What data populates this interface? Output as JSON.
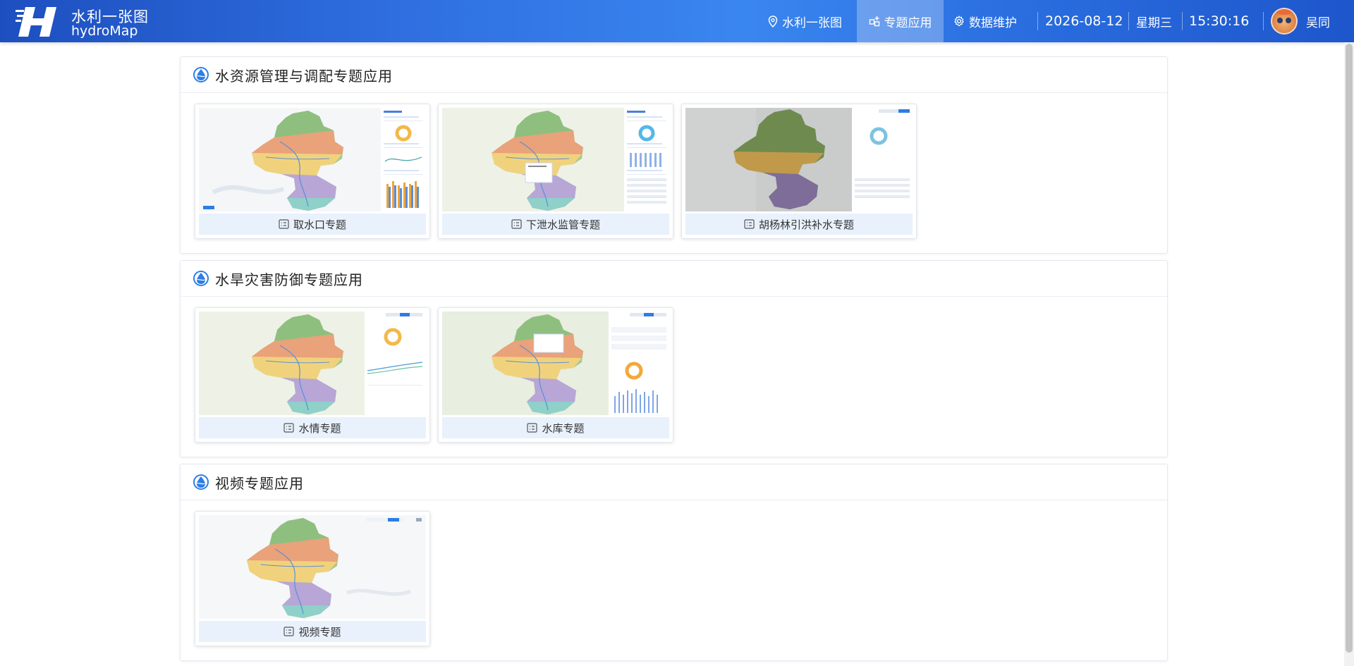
{
  "header": {
    "brand_cn": "水利一张图",
    "brand_en": "hydroMap",
    "nav": [
      {
        "label": "水利一张图",
        "icon": "location-pin-icon"
      },
      {
        "label": "专题应用",
        "icon": "grid-plus-icon",
        "active": true
      },
      {
        "label": "数据维护",
        "icon": "gear-icon"
      }
    ],
    "date": "2026-08-12",
    "weekday": "星期三",
    "time": "15:30:16",
    "user": "吴同"
  },
  "sections": [
    {
      "title": "水资源管理与调配专题应用",
      "cards": [
        {
          "label": "取水口专题"
        },
        {
          "label": "下泄水监管专题"
        },
        {
          "label": "胡杨林引洪补水专题"
        }
      ]
    },
    {
      "title": "水旱灾害防御专题应用",
      "cards": [
        {
          "label": "水情专题"
        },
        {
          "label": "水库专题"
        }
      ]
    },
    {
      "title": "视频专题应用",
      "cards": [
        {
          "label": "视频专题"
        }
      ]
    }
  ],
  "colors": {
    "header_start": "#1d4fbf",
    "header_end": "#3a86f0",
    "card_label_bg": "#e8f1fc",
    "accent": "#2d7de6"
  }
}
